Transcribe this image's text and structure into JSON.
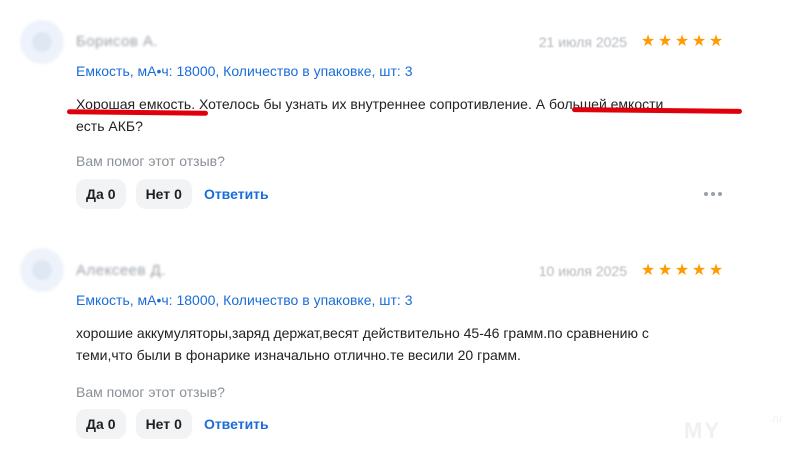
{
  "reviews": [
    {
      "author": "Борисов А.",
      "date": "21 июля 2025",
      "stars": [
        "★",
        "★",
        "★",
        "★",
        "★"
      ],
      "variant": "Емкость, мА•ч: 18000, Количество в упаковке, шт: 3",
      "text_line1_parts": [
        "Хорошая емкость",
        ". Хотелось бы узнать их внутреннее сопротивление. ",
        "А большей емкости"
      ],
      "text_line2": "есть АКБ?",
      "helpful_question": "Вам помог этот отзыв?",
      "yes_label": "Да",
      "yes_count": "0",
      "no_label": "Нет",
      "no_count": "0",
      "reply_label": "Ответить"
    },
    {
      "author": "Алексеев Д.",
      "date": "10 июля 2025",
      "stars": [
        "★",
        "★",
        "★",
        "★",
        "★"
      ],
      "variant": "Емкость, мА•ч: 18000, Количество в упаковке, шт: 3",
      "text_line1": "хорошие аккумуляторы,заряд держат,весят действительно 45-46 грамм.по сравнению с",
      "text_line2": "теми,что были в фонарике изначально отлично.те весили 20 грамм.",
      "helpful_question": "Вам помог этот отзыв?",
      "yes_label": "Да",
      "yes_count": "0",
      "no_label": "Нет",
      "no_count": "0",
      "reply_label": "Ответить"
    }
  ],
  "watermark": "MY",
  "watermark_suffix": ".ru",
  "colors": {
    "accent": "#1a6dd9",
    "star": "#ff9a00",
    "annotation": "#e0000c"
  }
}
